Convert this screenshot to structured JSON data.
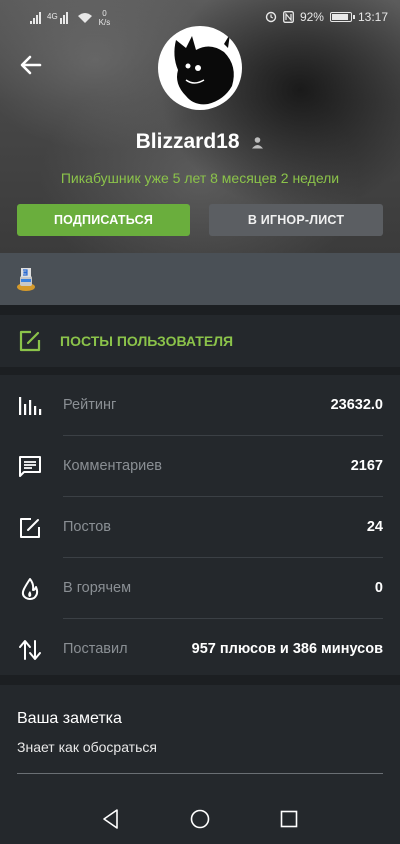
{
  "status_bar": {
    "net_speed_value": "0",
    "net_speed_unit": "K/s",
    "battery": "92%",
    "time": "13:17"
  },
  "profile": {
    "username": "Blizzard18",
    "tenure": "Пикабушник уже 5 лет 8 месяцев 2 недели"
  },
  "actions": {
    "subscribe_label": "ПОДПИСАТЬСЯ",
    "ignore_label": "В ИГНОР-ЛИСТ"
  },
  "posts_button": {
    "label": "ПОСТЫ ПОЛЬЗОВАТЕЛЯ"
  },
  "stats": [
    {
      "label": "Рейтинг",
      "value": "23632.0",
      "icon": "rating-bars-icon"
    },
    {
      "label": "Комментариев",
      "value": "2167",
      "icon": "comment-icon"
    },
    {
      "label": "Постов",
      "value": "24",
      "icon": "post-edit-icon"
    },
    {
      "label": "В горячем",
      "value": "0",
      "icon": "fire-icon"
    },
    {
      "label": "Поставил",
      "value": "957 плюсов и 386 минусов",
      "icon": "up-down-arrows-icon"
    }
  ],
  "note": {
    "title": "Ваша заметка",
    "text": "Знает как обосраться"
  },
  "colors": {
    "accent_green": "#6aae3d",
    "text_green": "#8bc34a",
    "panel": "#24282c",
    "background": "#1c1f22"
  }
}
